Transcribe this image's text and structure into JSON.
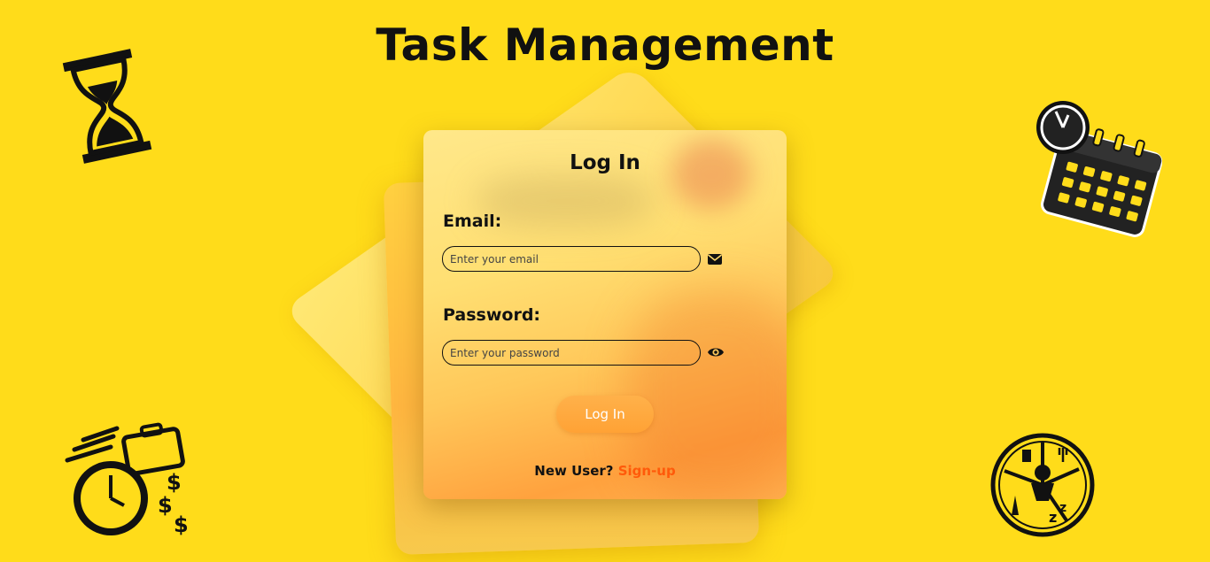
{
  "header": {
    "title": "Task Management"
  },
  "login_card": {
    "title": "Log In",
    "email_label": "Email:",
    "email_placeholder": "Enter your email",
    "password_label": "Password:",
    "password_placeholder": "Enter your password",
    "submit_label": "Log In",
    "new_user_text": "New User?",
    "signup_link": "Sign-up"
  },
  "icons": {
    "email": "envelope-icon",
    "password": "eye-icon",
    "decor_top_left": "hourglass-icon",
    "decor_top_right": "clock-calendar-icon",
    "decor_bottom_left": "time-money-icon",
    "decor_bottom_right": "daily-routine-icon"
  },
  "colors": {
    "background": "#ffdc1a",
    "button": "#ffa235",
    "link": "#ff5a0a"
  }
}
